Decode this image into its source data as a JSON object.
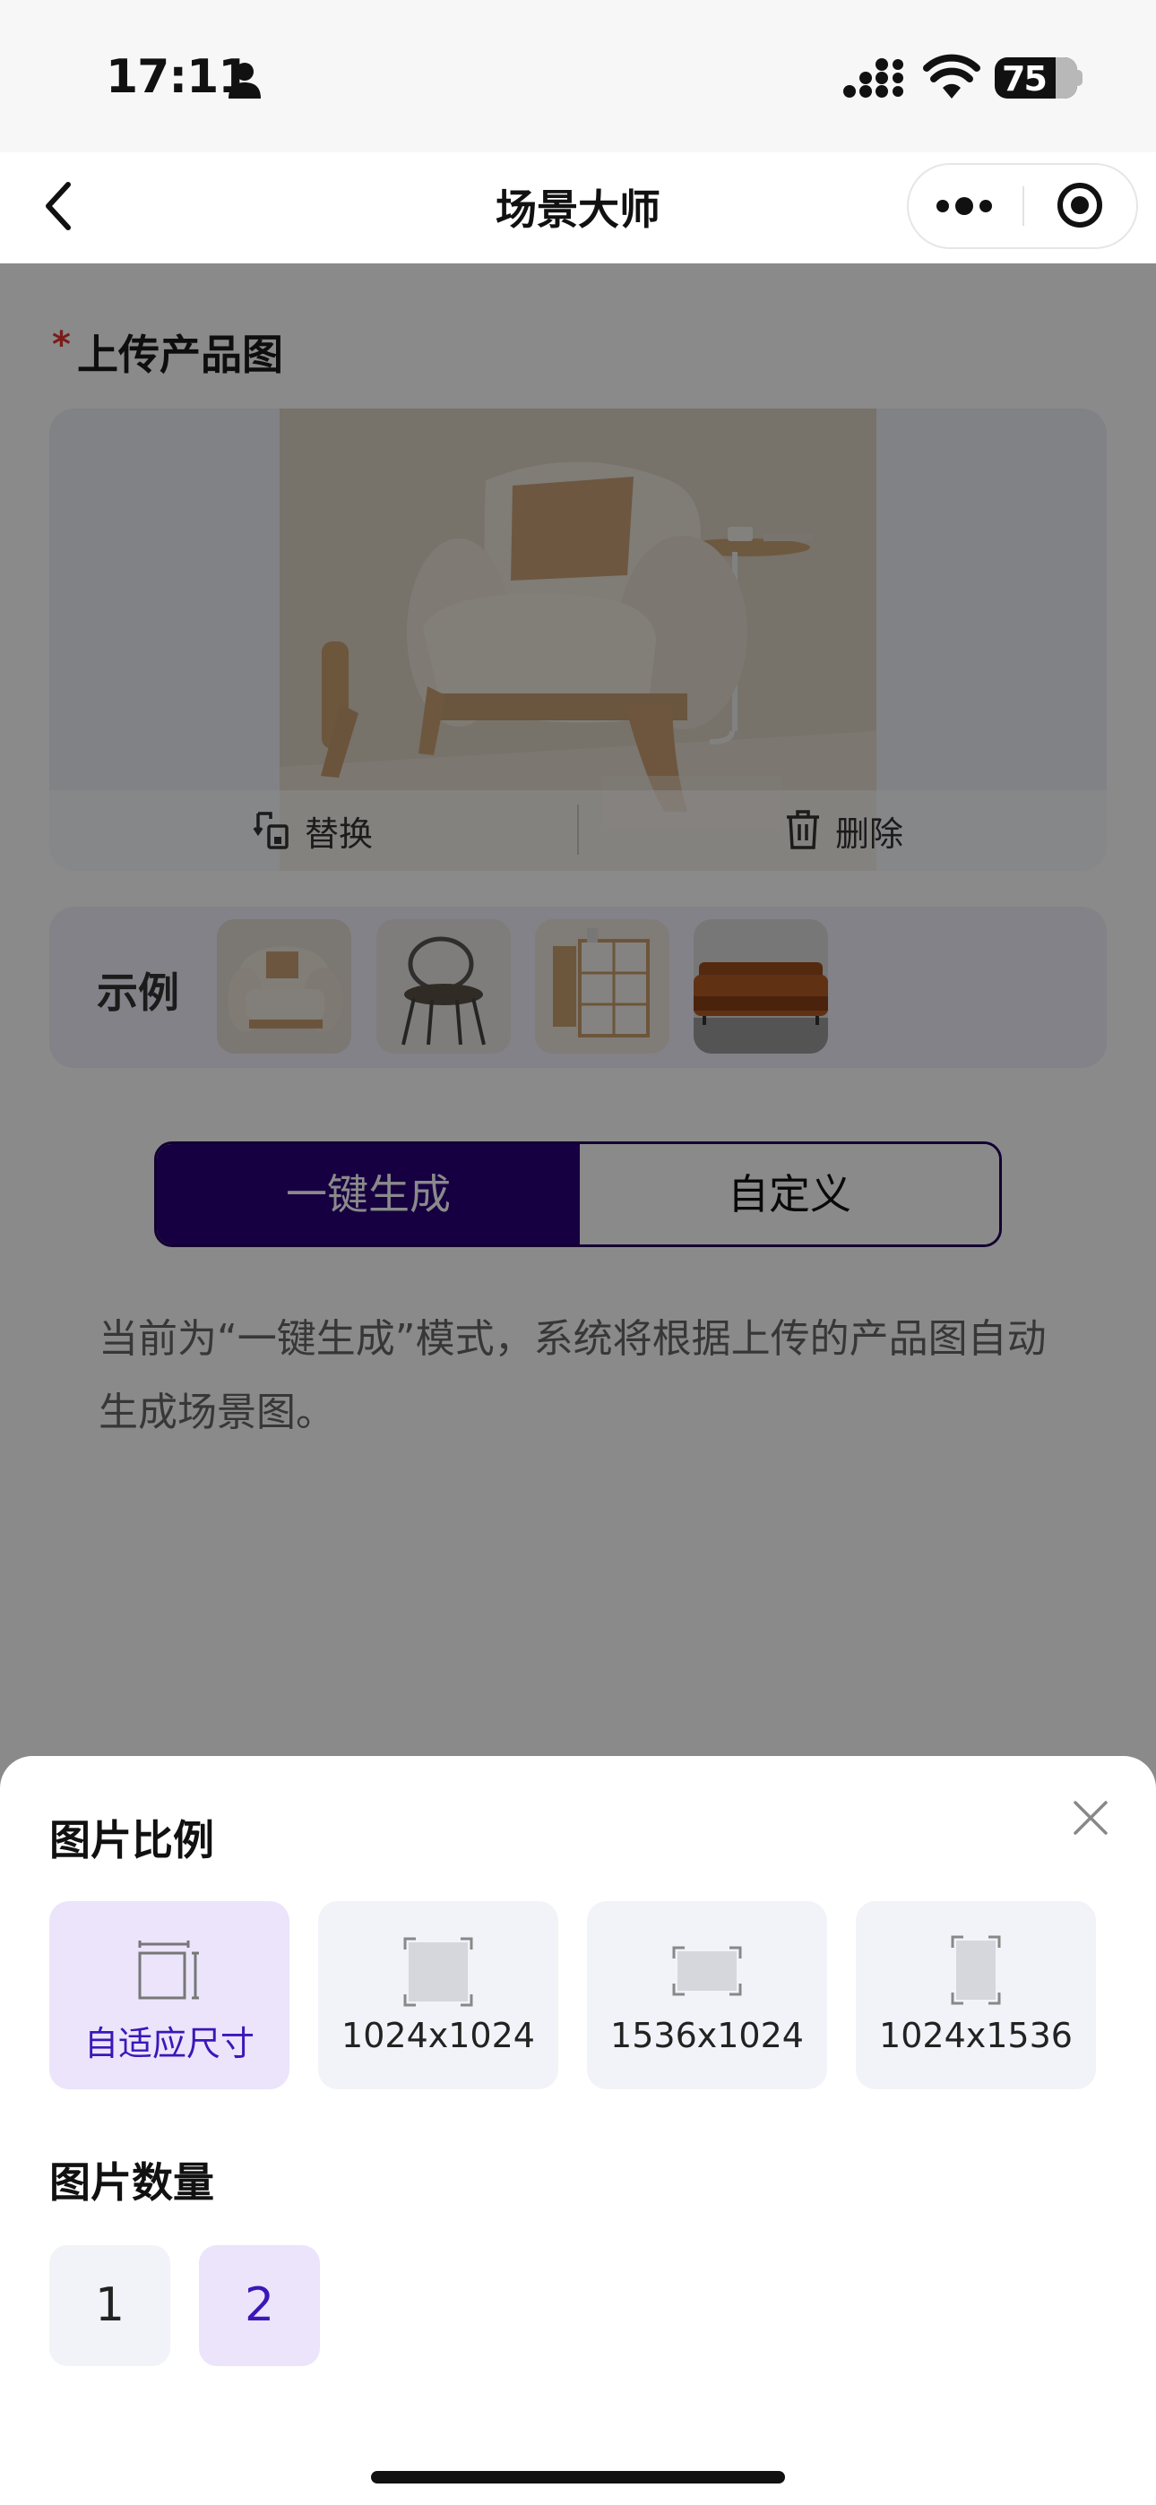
{
  "status_bar": {
    "time": "17:11",
    "battery": "75"
  },
  "nav": {
    "title": "场景大师"
  },
  "upload": {
    "required_mark": "*",
    "title": "上传产品图",
    "replace_label": "替换",
    "delete_label": "删除"
  },
  "examples": {
    "label": "示例",
    "thumbs": [
      "armchair",
      "chair",
      "cabinet",
      "sofa"
    ]
  },
  "mode": {
    "one_click": "一键生成",
    "custom": "自定义",
    "selected": "一键生成"
  },
  "description": "当前为“一键生成”模式，系统将根据上传的产品图自动生成场景图。",
  "sheet": {
    "ratio_title": "图片比例",
    "ratios": [
      {
        "label": "自适应尺寸",
        "selected": true
      },
      {
        "label": "1024x1024",
        "selected": false
      },
      {
        "label": "1536x1024",
        "selected": false
      },
      {
        "label": "1024x1536",
        "selected": false
      }
    ],
    "count_title": "图片数量",
    "counts": [
      {
        "label": "1",
        "selected": false
      },
      {
        "label": "2",
        "selected": true
      }
    ]
  },
  "colors": {
    "accent": "#2a0078",
    "selected_bg": "#ebe4fb",
    "selected_text": "#3b17b8",
    "required": "#e3342f"
  }
}
